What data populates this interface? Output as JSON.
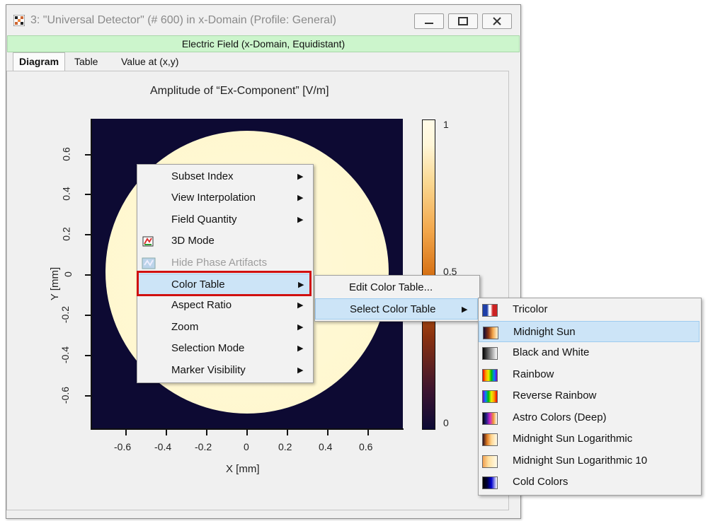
{
  "window": {
    "title": "3: \"Universal Detector\" (# 600) in x-Domain (Profile: General)",
    "subtitle": "Electric Field (x-Domain, Equidistant)",
    "subtitle_color": "#ccf5cc"
  },
  "tabs": [
    {
      "label": "Diagram",
      "active": true
    },
    {
      "label": "Table",
      "active": false
    },
    {
      "label": "Value at (x,y)",
      "active": false
    }
  ],
  "plot": {
    "title": "Amplitude of “Ex-Component”  [V/m]",
    "xlabel": "X [mm]",
    "ylabel": "Y [mm]",
    "xticks": [
      "-0.6",
      "-0.4",
      "-0.2",
      "0",
      "0.2",
      "0.4",
      "0.6"
    ],
    "yticks": [
      "0.6",
      "0.4",
      "0.2",
      "0",
      "-0.2",
      "-0.4",
      "-0.6"
    ],
    "colorbar_labels": [
      "1",
      "0.5",
      "0"
    ],
    "color_table": "Midnight Sun"
  },
  "context_menu": {
    "items": [
      {
        "label": "Subset Index",
        "submenu": true,
        "disabled": false,
        "icon": ""
      },
      {
        "label": "View Interpolation",
        "submenu": true,
        "disabled": false,
        "icon": ""
      },
      {
        "label": "Field Quantity",
        "submenu": true,
        "disabled": false,
        "icon": ""
      },
      {
        "label": "3D Mode",
        "submenu": false,
        "disabled": false,
        "icon": "3d-mode-icon"
      },
      {
        "label": "Hide Phase Artifacts",
        "submenu": false,
        "disabled": true,
        "icon": "phase-artifacts-icon"
      },
      {
        "label": "Color Table",
        "submenu": true,
        "disabled": false,
        "highlighted": true,
        "icon": ""
      },
      {
        "label": "Aspect Ratio",
        "submenu": true,
        "disabled": false,
        "icon": ""
      },
      {
        "label": "Zoom",
        "submenu": true,
        "disabled": false,
        "icon": ""
      },
      {
        "label": "Selection Mode",
        "submenu": true,
        "disabled": false,
        "icon": ""
      },
      {
        "label": "Marker Visibility",
        "submenu": true,
        "disabled": false,
        "icon": ""
      }
    ]
  },
  "color_table_menu": {
    "items": [
      {
        "label": "Edit Color Table...",
        "submenu": false
      },
      {
        "label": "Select Color Table",
        "submenu": true,
        "highlighted": true
      }
    ]
  },
  "select_color_table_menu": {
    "items": [
      {
        "label": "Tricolor",
        "swatch": "tricolor"
      },
      {
        "label": "Midnight Sun",
        "swatch": "midnight-sun",
        "highlighted": true
      },
      {
        "label": "Black and White",
        "swatch": "black-and-white"
      },
      {
        "label": "Rainbow",
        "swatch": "rainbow"
      },
      {
        "label": "Reverse Rainbow",
        "swatch": "reverse-rainbow"
      },
      {
        "label": "Astro Colors (Deep)",
        "swatch": "astro-colors-deep"
      },
      {
        "label": "Midnight Sun Logarithmic",
        "swatch": "midnight-sun-logarithmic"
      },
      {
        "label": "Midnight Sun Logarithmic 10",
        "swatch": "midnight-sun-logarithmic-10"
      },
      {
        "label": "Cold Colors",
        "swatch": "cold-colors"
      }
    ]
  },
  "colors": {
    "highlight": "#cce4f7",
    "annotation_box": "#d01010"
  }
}
